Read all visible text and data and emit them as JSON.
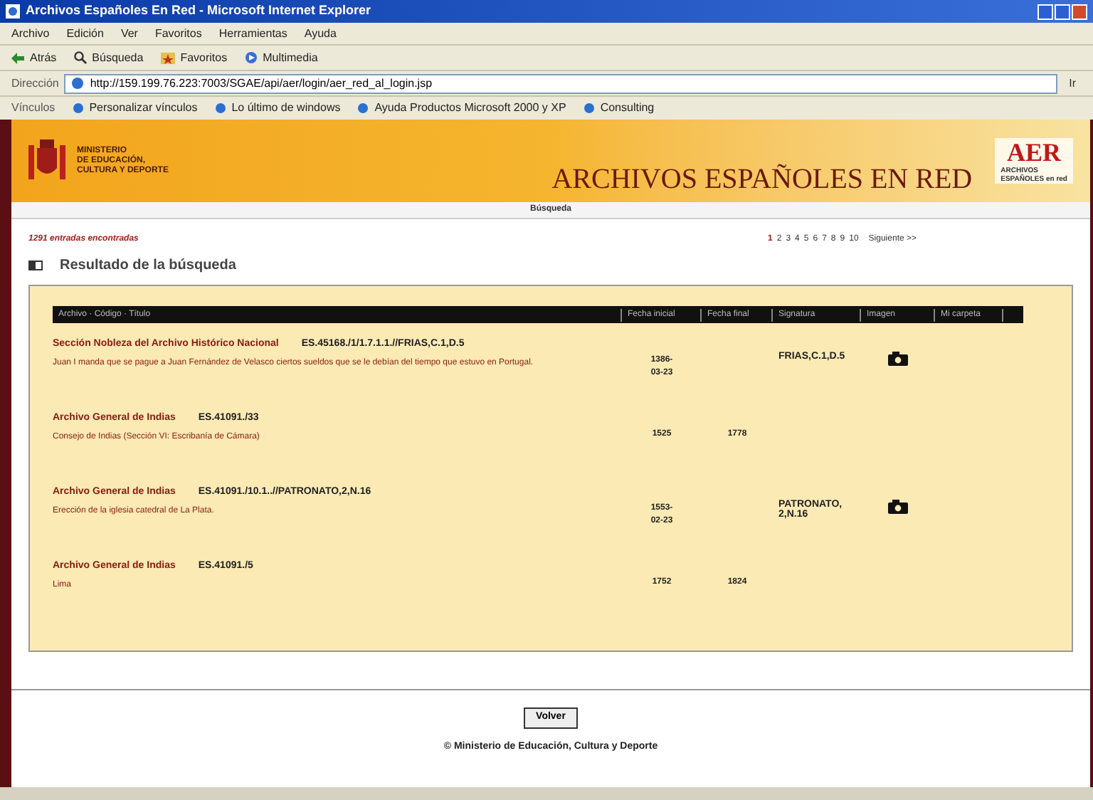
{
  "window": {
    "title": "Archivos Españoles En Red - Microsoft Internet Explorer"
  },
  "menu": [
    "Archivo",
    "Edición",
    "Ver",
    "Favoritos",
    "Herramientas",
    "Ayuda"
  ],
  "toolbar": [
    {
      "kind": "back",
      "label": "Atrás"
    },
    {
      "kind": "search",
      "label": "Búsqueda"
    },
    {
      "kind": "favorites",
      "label": "Favoritos"
    },
    {
      "kind": "media",
      "label": "Multimedia"
    }
  ],
  "address": {
    "label": "Dirección",
    "value": "http://159.199.76.223:7003/SGAE/api/aer/login/aer_red_al_login.jsp",
    "go": "Ir"
  },
  "links": {
    "label": "Vínculos",
    "items": [
      "Personalizar vínculos",
      "Lo último de windows",
      "Ayuda Productos Microsoft 2000 y XP",
      "Consulting"
    ]
  },
  "header": {
    "ministry": "MINISTERIO\nDE EDUCACIÓN,\nCULTURA Y DEPORTE",
    "title": "ARCHIVOS ESPAÑOLES EN RED",
    "logo": "AER",
    "logo_caption": "ARCHIVOS\nESPAÑOLES en red"
  },
  "nav": "Búsqueda",
  "count": "1291 entradas encontradas",
  "pages": [
    {
      "label": "1",
      "selected": true
    },
    {
      "label": "2",
      "selected": false
    },
    {
      "label": "3",
      "selected": false
    },
    {
      "label": "4",
      "selected": false
    },
    {
      "label": "5",
      "selected": false
    },
    {
      "label": "6",
      "selected": false
    },
    {
      "label": "7",
      "selected": false
    },
    {
      "label": "8",
      "selected": false
    },
    {
      "label": "9",
      "selected": false
    },
    {
      "label": "10",
      "selected": false
    }
  ],
  "next": "Siguiente >>",
  "heading": "Resultado de la búsqueda",
  "table": {
    "columns": [
      "Archivo · Código · Título",
      "Fecha inicial",
      "Fecha final",
      "Signatura",
      "Imagen",
      "Mi carpeta"
    ],
    "rows": [
      {
        "archive": "Sección Nobleza del Archivo Histórico Nacional",
        "code": "ES.45168./1/1.7.1.1.//FRIAS,C.1,D.5",
        "title": "Juan I manda que se pague a Juan Fernández de Velasco ciertos sueldos que se le debían del tiempo que estuvo en Portugal.",
        "start": "1386-03-23",
        "end": "",
        "signature": "FRIAS,C.1,D.5",
        "image": true
      },
      {
        "archive": "Archivo General de Indias",
        "code": "ES.41091./33",
        "title": "Consejo de Indias (Sección VI: Escribanía de Cámara)",
        "start": "1525",
        "end": "1778",
        "signature": "",
        "image": false
      },
      {
        "archive": "Archivo General de Indias",
        "code": "ES.41091./10.1..//PATRONATO,2,N.16",
        "title": "Erección de la iglesia catedral de La Plata.",
        "start": "1553-02-23",
        "end": "",
        "signature": "PATRONATO, 2,N.16",
        "image": true
      },
      {
        "archive": "Archivo General de Indias",
        "code": "ES.41091./5",
        "title": "Lima",
        "start": "1752",
        "end": "1824",
        "signature": "",
        "image": false
      }
    ]
  },
  "back_button": "Volver",
  "copyright": "© Ministerio de Educación, Cultura y Deporte"
}
